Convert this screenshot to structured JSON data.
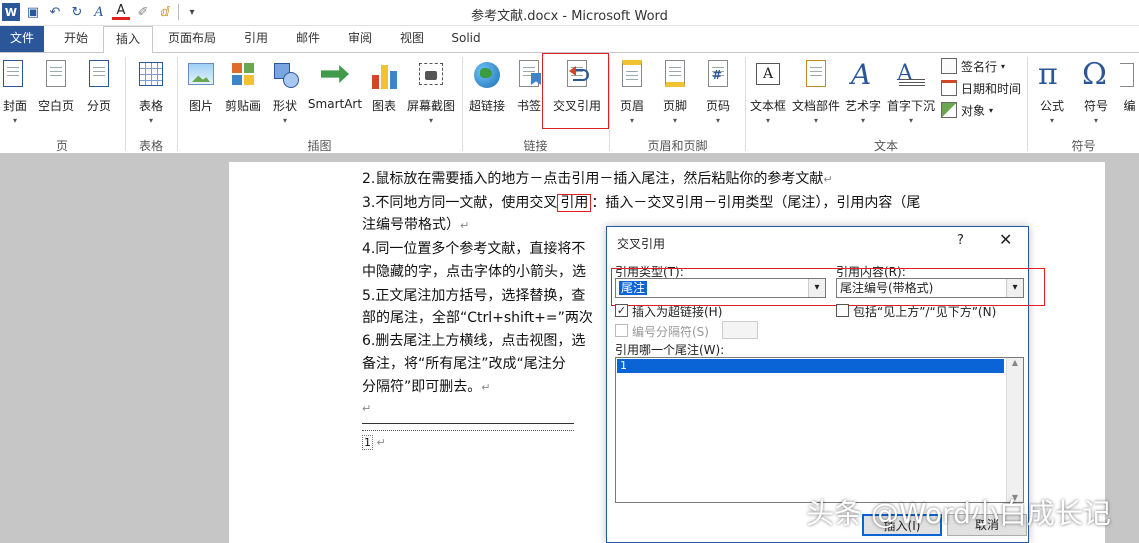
{
  "window": {
    "title": "参考文献.docx - Microsoft Word"
  },
  "quick_access": [
    {
      "icon": "word-logo-icon",
      "glyph": "W"
    },
    {
      "icon": "save-icon",
      "glyph": "▣"
    },
    {
      "icon": "undo-icon",
      "glyph": "↶"
    },
    {
      "icon": "redo-icon",
      "glyph": "↻"
    },
    {
      "icon": "text-effects-icon",
      "glyph": "A"
    },
    {
      "icon": "font-color-icon",
      "glyph": "A"
    },
    {
      "icon": "eraser-icon",
      "glyph": "✐"
    },
    {
      "icon": "format-painter-icon",
      "glyph": "ⅆ"
    },
    {
      "icon": "customize-icon",
      "glyph": "▾"
    }
  ],
  "tabs": [
    "文件",
    "开始",
    "插入",
    "页面布局",
    "引用",
    "邮件",
    "审阅",
    "视图",
    "Solid"
  ],
  "ribbon": {
    "buttons": [
      "封面",
      "空白页",
      "分页",
      "表格",
      "图片",
      "剪贴画",
      "形状",
      "SmartArt",
      "图表",
      "屏幕截图",
      "超链接",
      "书签",
      "交叉引用",
      "页眉",
      "页脚",
      "页码",
      "文本框",
      "文档部件",
      "艺术字",
      "首字下沉",
      "公式",
      "符号",
      "编"
    ],
    "small_buttons": [
      "签名行",
      "日期和时间",
      "对象"
    ],
    "groups": [
      "页",
      "表格",
      "插图",
      "链接",
      "页眉和页脚",
      "文本",
      "符号"
    ],
    "accent": "#e02020"
  },
  "document": {
    "lines": [
      "2.鼠标放在需要插入的地方－点击引用－插入尾注，然后粘贴你的参考文献",
      "3.不同地方同一文献，使用交叉",
      "引用",
      "插入－交叉引用－引用类型（尾注），引用内容（尾",
      "注编号带格式）",
      "4.同一位置多个参考文献，直接将不",
      "中隐藏的字，点击字体的小箭头，选",
      "5.正文尾注加方括号，选择替换，查",
      "部的尾注，全部“Ctrl+shift+=”两次",
      "6.删去尾注上方横线，点击视图，选",
      "备注，将“所有尾注”改成“尾注分",
      "分隔符”即可删去。"
    ],
    "para_mark": "↵",
    "endnote_mark": "1"
  },
  "dialog": {
    "title": "交叉引用",
    "help": "?",
    "close": "✕",
    "ref_type_label": "引用类型(T):",
    "ref_type_value": "尾注",
    "ref_content_label": "引用内容(R):",
    "ref_content_value": "尾注编号(带格式)",
    "insert_hyperlink_label": "插入为超链接(H)",
    "include_above_below_label": "包括“见上方”/“见下方”(N)",
    "separator_label": "编号分隔符(S)",
    "which_label": "引用哪一个尾注(W):",
    "list_items": [
      "1"
    ],
    "insert_button": "插入(I)",
    "cancel_button": "取消"
  },
  "watermark": "头条 @Word小白成长记"
}
